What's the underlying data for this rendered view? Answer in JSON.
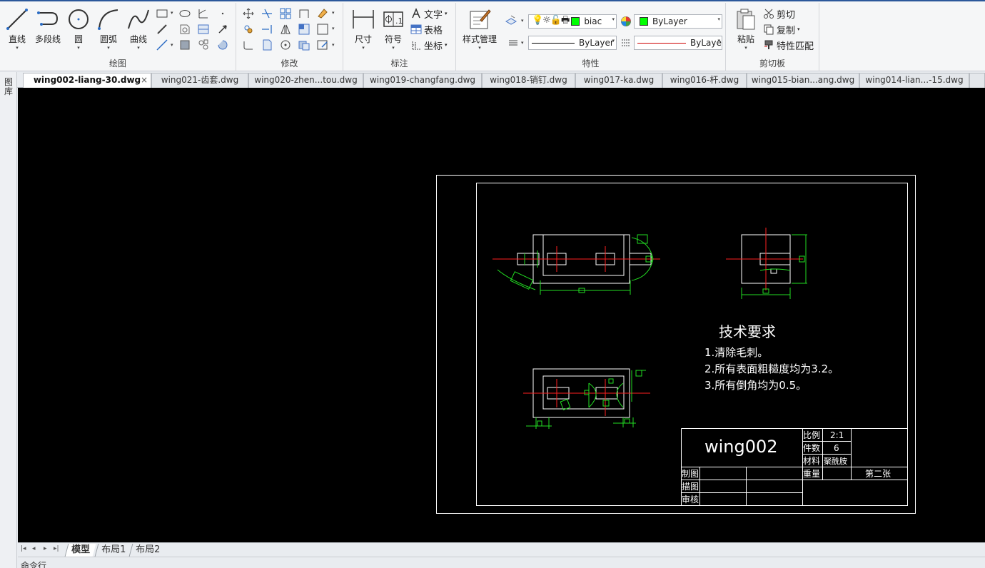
{
  "ribbon": {
    "draw": {
      "title": "绘图",
      "line": "直线",
      "polyline": "多段线",
      "circle": "圆",
      "arc": "圆弧",
      "curve": "曲线"
    },
    "modify": {
      "title": "修改"
    },
    "annotate": {
      "title": "标注",
      "dimension": "尺寸",
      "symbol": "符号",
      "text": "文字",
      "table": "表格",
      "coord": "坐标"
    },
    "properties": {
      "title": "特性",
      "style_manager": "样式管理",
      "layer_value": "biac",
      "color_value": "ByLayer",
      "linetype_value": "ByLayer",
      "lineweight_value": "ByLaye",
      "layer_color": "#00ff00",
      "linetype_color": "#000000",
      "lineweight_color": "#cc0000"
    },
    "clipboard": {
      "title": "剪切板",
      "paste": "粘贴",
      "cut": "剪切",
      "copy": "复制",
      "match": "特性匹配"
    }
  },
  "tabs": [
    {
      "label": "wing002-liang-30.dwg",
      "active": true
    },
    {
      "label": "wing021-齿套.dwg"
    },
    {
      "label": "wing020-zhen...tou.dwg"
    },
    {
      "label": "wing019-changfang.dwg"
    },
    {
      "label": "wing018-销钉.dwg"
    },
    {
      "label": "wing017-ka.dwg"
    },
    {
      "label": "wing016-杆.dwg"
    },
    {
      "label": "wing015-bian...ang.dwg"
    },
    {
      "label": "wing014-lian...-15.dwg"
    }
  ],
  "tab_close": "×",
  "sidebar": {
    "label": "图库"
  },
  "drawing": {
    "tech_title": "技术要求",
    "tech_items": [
      "1.清除毛刺。",
      "2.所有表面粗糙度均为3.2。",
      "3.所有倒角均为0.5。"
    ],
    "title_block": {
      "part_name": "wing002",
      "scale_label": "比例",
      "scale_value": "2:1",
      "qty_label": "件数",
      "qty_value": "6",
      "material_label": "材料",
      "material_value": "聚酰胺",
      "drawn_label": "制图",
      "traced_label": "描图",
      "checked_label": "审核",
      "weight_label": "重量",
      "sheet_label": "第二张"
    }
  },
  "layout_tabs": [
    "模型",
    "布局1",
    "布局2"
  ],
  "nav_arrows": [
    "|◂",
    "◂",
    "▸",
    "▸|"
  ],
  "command_line": "命令行"
}
